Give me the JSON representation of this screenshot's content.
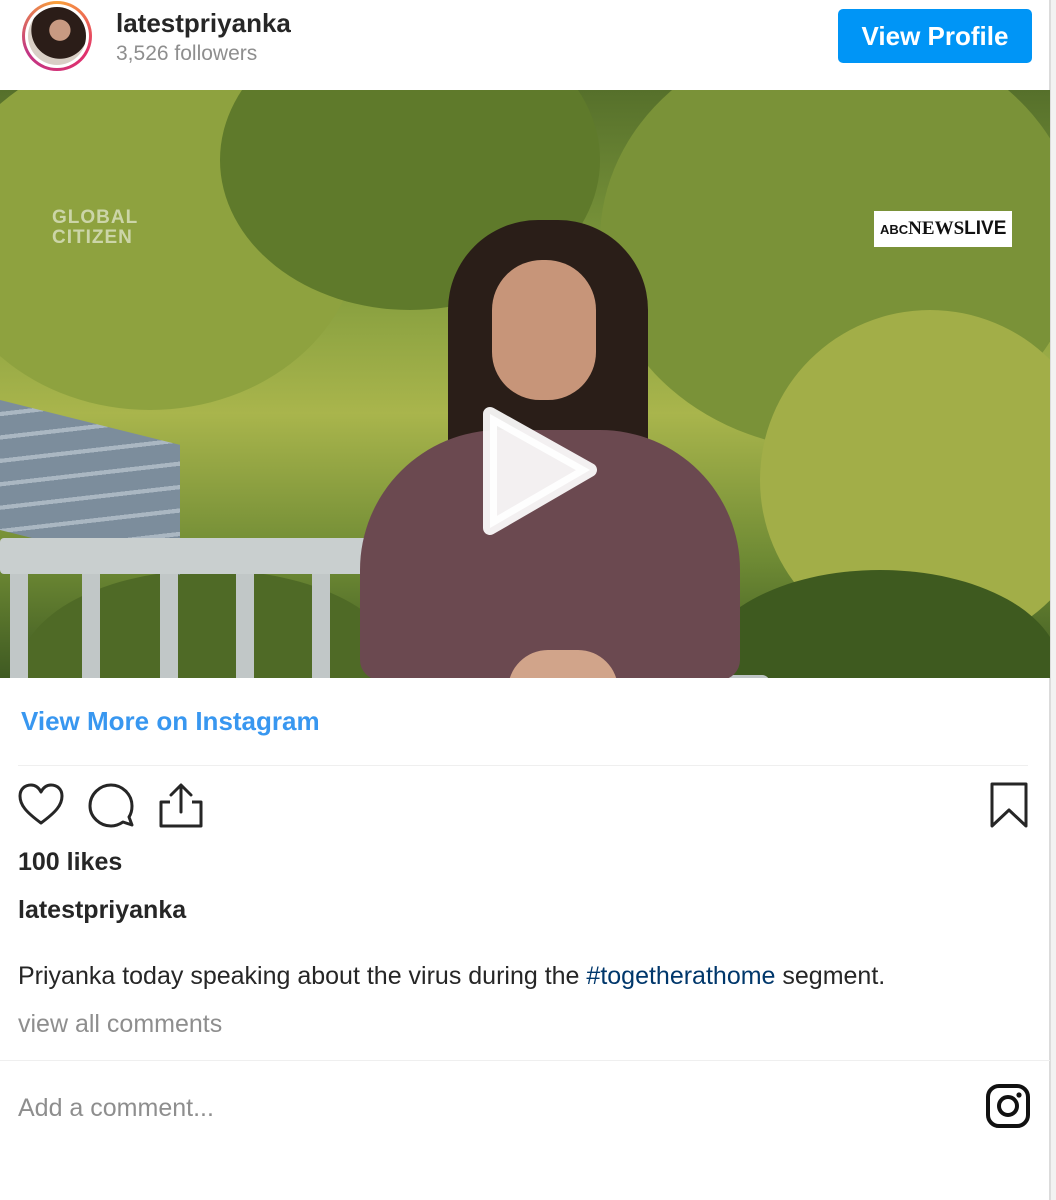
{
  "header": {
    "username": "latestpriyanka",
    "followers": "3,526 followers",
    "view_profile_label": "View Profile"
  },
  "media": {
    "watermark_line1": "GLOBAL",
    "watermark_line2": "CITIZEN",
    "news_badge_prefix": "ABC",
    "news_badge_news": "NEWS",
    "news_badge_live": "LIVE",
    "abc_logo": "abc",
    "play_icon": "play-icon"
  },
  "links": {
    "view_more": "View More on Instagram"
  },
  "actions": {
    "like_icon": "heart-icon",
    "comment_icon": "comment-icon",
    "share_icon": "share-icon",
    "save_icon": "bookmark-icon"
  },
  "post": {
    "likes": "100 likes",
    "caption_user": "latestpriyanka",
    "caption_before": "Priyanka today speaking about the virus during the ",
    "hashtag": "#togetherathome",
    "caption_after": " segment.",
    "view_comments": "view all comments"
  },
  "comment": {
    "placeholder": "Add a comment..."
  },
  "colors": {
    "accent_blue": "#0095f6",
    "link_blue": "#3897f0",
    "hashtag_blue": "#00376b",
    "muted_gray": "#8e8e8e"
  }
}
